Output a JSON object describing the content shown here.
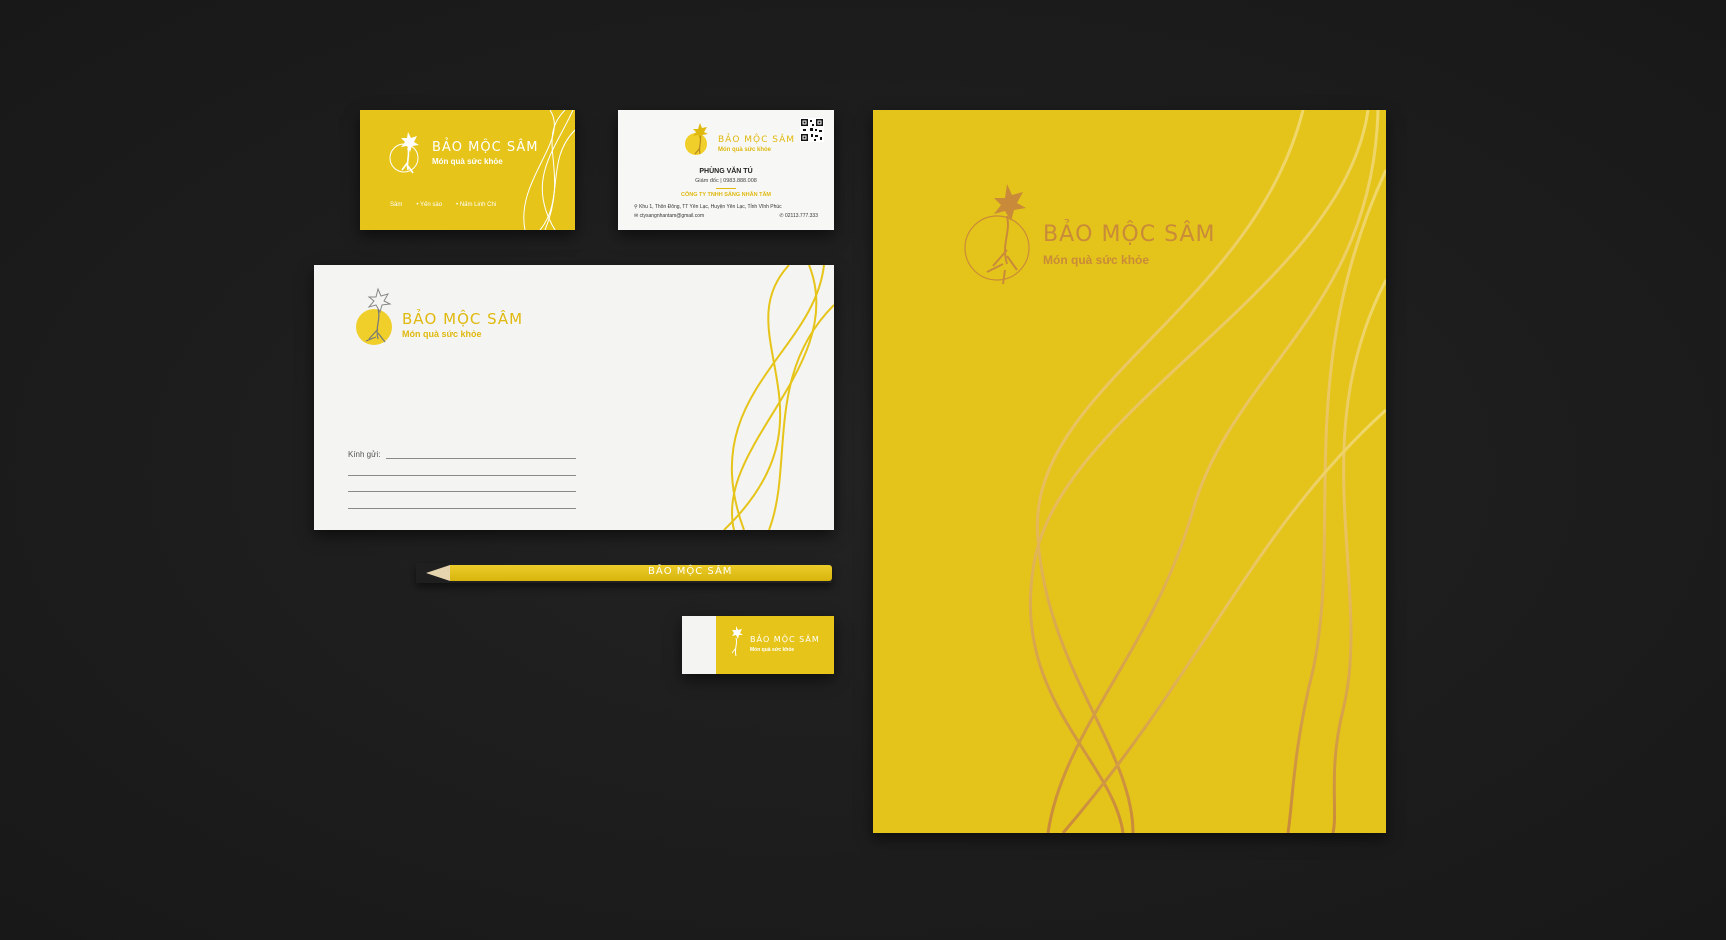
{
  "brand": {
    "name": "BẢO MỘC SÂM",
    "tagline": "Món quà sức khỏe"
  },
  "card_front": {
    "products": [
      "Sâm",
      "Yến sào",
      "Nấm Linh Chi"
    ]
  },
  "card_back": {
    "person_name": "PHÙNG VĂN TÚ",
    "role": "Giám đốc  |  0983.888.008",
    "company": "CÔNG TY TNHH SÁNG NHÂN TÂM",
    "address": "Khu 1, Thôn Đông, TT Yên Lạc, Huyện Yên Lạc, Tỉnh Vĩnh Phúc",
    "email": "ctysangnhantam@gmail.com",
    "phone": "02113.777.333"
  },
  "envelope": {
    "to_label": "Kính gửi:"
  },
  "colors": {
    "background": "#1c1c1c",
    "brand_yellow": "#e6c419",
    "accent_gold": "#c98a3a",
    "paper_white": "#f4f4f2"
  },
  "icons": [
    "ginseng-logo-icon",
    "qr-code-icon",
    "location-icon",
    "email-icon",
    "phone-icon"
  ]
}
